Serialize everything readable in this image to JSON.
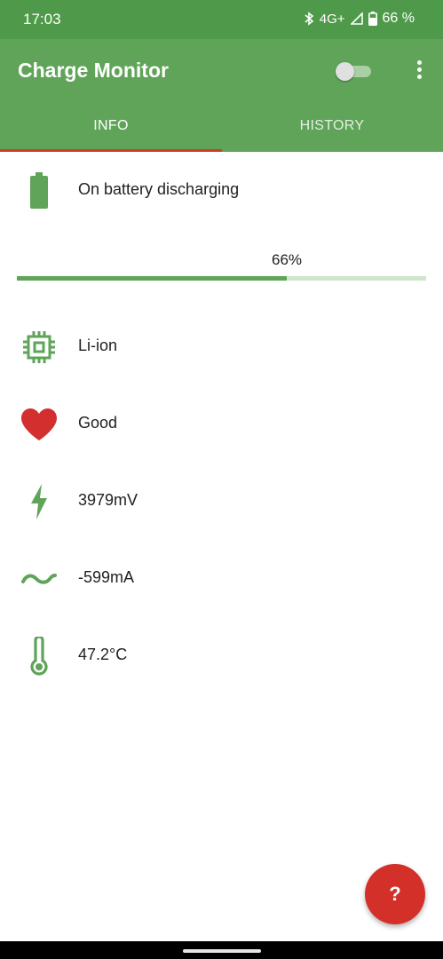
{
  "status_bar": {
    "time": "17:03",
    "network": "4G+",
    "battery_percent": "66 %"
  },
  "app_bar": {
    "title": "Charge Monitor",
    "toggle_on": false
  },
  "tabs": [
    {
      "label": "INFO",
      "selected": true
    },
    {
      "label": "HISTORY",
      "selected": false
    }
  ],
  "battery": {
    "status": "On battery discharging",
    "level_text": "66%",
    "level": 0.66,
    "technology": "Li-ion",
    "health": "Good",
    "voltage": "3979mV",
    "current": "-599mA",
    "temperature": "47.2°C"
  },
  "icons": {
    "status": "battery-icon",
    "technology": "chip-icon",
    "health": "heart-icon",
    "voltage": "lightning-bolt-icon",
    "current": "wave-icon",
    "temperature": "thermometer-icon"
  },
  "fab": {
    "label": "?"
  },
  "colors": {
    "status_bar": "#4f9a4a",
    "app_bar": "#5fa458",
    "accent_green": "#5fa458",
    "tab_indicator": "#d23a2a",
    "heart": "#d32f2f",
    "fab": "#d4302a"
  }
}
